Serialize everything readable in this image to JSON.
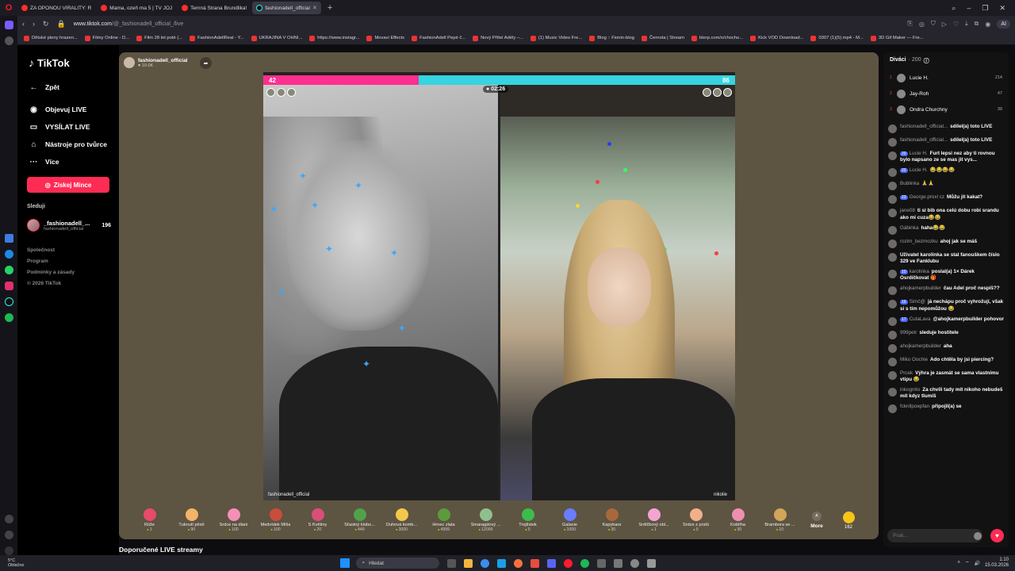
{
  "browser": {
    "tabs": [
      {
        "title": "ZA OPONOU VIRALITY: R",
        "active": false
      },
      {
        "title": "Mama, ozeň ma 5 | TV JOJ",
        "active": false
      },
      {
        "title": "Temná Strana Brundlika!",
        "active": false
      },
      {
        "title": "fashionadell_official",
        "active": true
      }
    ],
    "url_host": "www.tiktok.com",
    "url_path": "/@_fashionadell_official_/live",
    "ai_label": "AI",
    "bookmarks": [
      "Dětské pleny hrazen...",
      "Filmy Online - D...",
      "Film 28 let poté (...",
      "FashionAdellReal - Y...",
      "UKRAJINA V OHNI...",
      "https://www.instagr...",
      "Movavi Effects",
      "FashionAdell Pepé č...",
      "Nový Přítel Adély –...",
      "(1) Music Video Fre...",
      "Blog :: Fionin-blog",
      "Černota | Stream",
      "blerp.com/x/chocho...",
      "Kick VOD Download...",
      "0307 (1)(5).mp4 - M...",
      "3D Gif Maker — Fre..."
    ]
  },
  "tiktok": {
    "logo": "TikTok",
    "back": "Zpět",
    "nav": [
      {
        "label": "Objevuj LIVE",
        "icon": "live-icon"
      },
      {
        "label": "VYSÍLAT LIVE",
        "icon": "camera-icon"
      },
      {
        "label": "Nástroje pro tvůrce",
        "icon": "tools-icon"
      },
      {
        "label": "Více",
        "icon": "more-icon"
      }
    ],
    "coins_button": "Získej Mince",
    "following_title": "Sleduji",
    "following": {
      "name": "_fashionadell_...",
      "sub": "fashionadell_official",
      "count": "196"
    },
    "footer_links": [
      "Společnost",
      "Program",
      "Podmínky a zásady",
      "© 2026 TikTok"
    ]
  },
  "stream": {
    "host_name": "fashionadell_official",
    "host_likes": "10.0K",
    "score_left": "42",
    "score_right": "86",
    "score_left_fraction": 0.33,
    "timer": "02:26",
    "left_label": "fashionadell_official",
    "right_label": "nikolie"
  },
  "gifts": [
    {
      "name": "Růže",
      "price": "1",
      "color": "#e84a6a"
    },
    {
      "name": "Ťuknutí pěstí",
      "price": "90",
      "color": "#f2b36a"
    },
    {
      "name": "Srdce na dlani",
      "price": "100",
      "color": "#f58fb6"
    },
    {
      "name": "Medvídek Míša",
      "price": "100",
      "color": "#c84d3c"
    },
    {
      "name": "S Květiny",
      "price": "20",
      "color": "#d94f7a"
    },
    {
      "name": "Šťastný klobo...",
      "price": "449",
      "color": "#4fa24a"
    },
    {
      "name": "Duhová komb...",
      "price": "3000",
      "color": "#f1c84c"
    },
    {
      "name": "Hrnec zlata",
      "price": "4999",
      "color": "#5c9b3c"
    },
    {
      "name": "Smaragdový ...",
      "price": "12000",
      "color": "#8fbf8f"
    },
    {
      "name": "Trojlístek",
      "price": "5",
      "color": "#3dbb4c"
    },
    {
      "name": "Galaxie",
      "price": "1000",
      "color": "#6a7cff"
    },
    {
      "name": "Kapybara",
      "price": "30",
      "color": "#a8683c"
    },
    {
      "name": "Srdíčkový obl...",
      "price": "1",
      "color": "#f2a5d2"
    },
    {
      "name": "Srdce z prstů",
      "price": "5",
      "color": "#f0b08a"
    },
    {
      "name": "Koblíha",
      "price": "30",
      "color": "#ee8fb0"
    },
    {
      "name": "Brambora se ...",
      "price": "10",
      "color": "#d2a55a"
    }
  ],
  "gift_more": "More",
  "coin_balance": "162",
  "recommended": "Doporučené LIVE streamy",
  "chat": {
    "viewers_title": "Diváci",
    "viewers_count": "200",
    "top_viewers": [
      {
        "rank": "1",
        "name": "Lucie H.",
        "score": "214"
      },
      {
        "rank": "2",
        "name": "Jay-Roh",
        "score": "47"
      },
      {
        "rank": "3",
        "name": "Ondra Churchny",
        "score": "39"
      }
    ],
    "messages": [
      {
        "user": "fashionadell_official...",
        "badge": "",
        "text": "sdílel(a) toto LIVE"
      },
      {
        "user": "fashionadell_official...",
        "badge": "",
        "text": "sdílel(a) toto LIVE"
      },
      {
        "user": "Lucie H.",
        "badge": "20",
        "text": "Furt lepsi nez aby ti rovnou bylo napsano ze se mas jit vys..."
      },
      {
        "user": "Lucie H.",
        "badge": "20",
        "text": "😂😂😂😂"
      },
      {
        "user": "Bublinka",
        "badge": "",
        "text": "🙏🙏"
      },
      {
        "user": "George.proxl cz",
        "badge": "23",
        "text": "Můžu jít kakat?"
      },
      {
        "user": "jane08",
        "badge": "",
        "text": "ti si bib ona celú dobu robi srandu ako mi cuza😂😂"
      },
      {
        "user": "Gábinka",
        "badge": "",
        "text": "haha😂😂"
      },
      {
        "user": "rozim_bezmozku",
        "badge": "",
        "text": "ahoj jak se máš"
      },
      {
        "user": "",
        "badge": "",
        "text": "Uživatel karolinka se stal fanouškem číslo 329 ve Fanklubu"
      },
      {
        "user": "karolinka",
        "badge": "10",
        "text": "poslal(a) 1× Dárek Osrdíčkovat 🎁"
      },
      {
        "user": "ahojkamerpbuilder",
        "badge": "",
        "text": "čau Adel proč nespíš??"
      },
      {
        "user": "Simč@",
        "badge": "16",
        "text": "já nechápu proč vyhrožují, však si s tím nepomůžou 😂"
      },
      {
        "user": "CutaLava",
        "badge": "17",
        "text": "@ahojkamerpbuilder pohovor"
      },
      {
        "user": "999petr",
        "badge": "",
        "text": "sleduje hostitele"
      },
      {
        "user": "ahojkamerpbuilder",
        "badge": "",
        "text": "aha"
      },
      {
        "user": "Miko Oochie",
        "badge": "",
        "text": "Ado chtěla by jsi piercing?"
      },
      {
        "user": "Prcek",
        "badge": "",
        "text": "Výhra je zasmát se sama vlastnímu vtipu 😂"
      },
      {
        "user": "inkognito",
        "badge": "",
        "text": "Za chvíli tady mít nikoho nebudeš mít kdyz tlumíš"
      },
      {
        "user": "fcknllpoepfan",
        "badge": "",
        "text": "připojil(a) se"
      }
    ],
    "input_placeholder": "Psát..."
  },
  "taskbar": {
    "temp": "5°C",
    "weather": "Oblačno",
    "search": "Hledat",
    "time": "1:10",
    "date": "15.03.2026"
  },
  "colors": {
    "accent": "#fe2c55",
    "score_left": "#ff2f8f",
    "score_right": "#35d4e0"
  }
}
